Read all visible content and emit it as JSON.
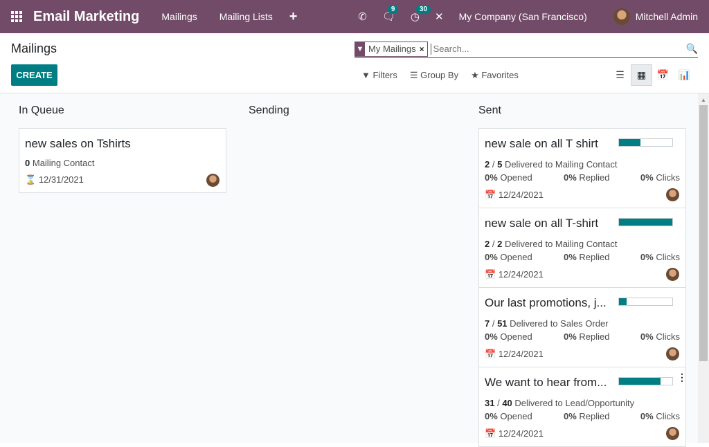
{
  "navbar": {
    "app_name": "Email Marketing",
    "menus": [
      "Mailings",
      "Mailing Lists"
    ],
    "messages_count": "9",
    "activities_count": "30",
    "company": "My Company (San Francisco)",
    "user": "Mitchell Admin",
    "bg_color": "#714b67"
  },
  "control_panel": {
    "title": "Mailings",
    "create_label": "CREATE",
    "facet_label": "My Mailings",
    "search_placeholder": "Search...",
    "filters_label": "Filters",
    "group_by_label": "Group By",
    "favorites_label": "Favorites"
  },
  "columns": {
    "queue": {
      "title": "In Queue",
      "card": {
        "name": "new sales on Tshirts",
        "recipients": "0",
        "recipients_label": "Mailing Contact",
        "date": "12/31/2021"
      }
    },
    "sending": {
      "title": "Sending"
    },
    "sent": {
      "title": "Sent",
      "cards": [
        {
          "name": "new sale on all T shirt",
          "delivered": "2",
          "total": "5",
          "target": "Delivered to Mailing Contact",
          "opened": "0%",
          "replied": "0%",
          "clicks": "0%",
          "date": "12/24/2021",
          "progress": 0.4
        },
        {
          "name": "new sale on all T-shirt",
          "delivered": "2",
          "total": "2",
          "target": "Delivered to Mailing Contact",
          "opened": "0%",
          "replied": "0%",
          "clicks": "0%",
          "date": "12/24/2021",
          "progress": 1.0
        },
        {
          "name": "Our last promotions, j...",
          "delivered": "7",
          "total": "51",
          "target": "Delivered to Sales Order",
          "opened": "0%",
          "replied": "0%",
          "clicks": "0%",
          "date": "12/24/2021",
          "progress": 0.14
        },
        {
          "name": "We want to hear from...",
          "delivered": "31",
          "total": "40",
          "target": "Delivered to Lead/Opportunity",
          "opened": "0%",
          "replied": "0%",
          "clicks": "0%",
          "date": "12/24/2021",
          "progress": 0.78
        }
      ]
    }
  },
  "labels": {
    "opened": "Opened",
    "replied": "Replied",
    "clicks": "Clicks"
  },
  "accent_color": "#017e84"
}
